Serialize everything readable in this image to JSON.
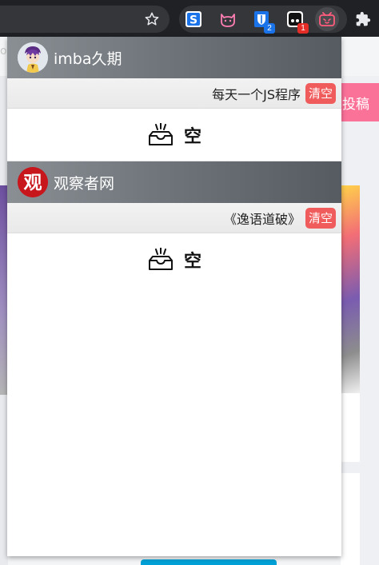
{
  "browser": {
    "bookmark_icon": "star-icon",
    "extensions": [
      {
        "name": "s-extension-icon",
        "badge": "",
        "color": "#1a73e8"
      },
      {
        "name": "cat-extension-icon",
        "badge": "",
        "color": "#ff7eb3"
      },
      {
        "name": "bitwarden-extension-icon",
        "badge": "2",
        "badge_color": "#1a73e8",
        "color": "#1a73e8"
      },
      {
        "name": "tv-extension-icon",
        "badge": "1",
        "badge_color": "#e52d27",
        "color": "#000000"
      },
      {
        "name": "bilibili-extension-icon",
        "badge": "",
        "color": "#ff5c7c"
      }
    ],
    "extensions_menu_icon": "puzzle-icon"
  },
  "background_page": {
    "upload_button": "投稿",
    "left_fragment": "oi"
  },
  "popup": {
    "groups": [
      {
        "name": "imba久期",
        "avatar": "anime-avatar",
        "video_title": "每天一个JS程序",
        "clear_label": "清空",
        "empty_text": "空"
      },
      {
        "name": "观察者网",
        "avatar": "观",
        "video_title": "《逸语道破》",
        "clear_label": "清空",
        "empty_text": "空"
      }
    ]
  },
  "colors": {
    "header_start": "#8a8f94",
    "header_end": "#555b61",
    "clear_button": "#f05b5b",
    "accent_pink": "#fb7299"
  }
}
